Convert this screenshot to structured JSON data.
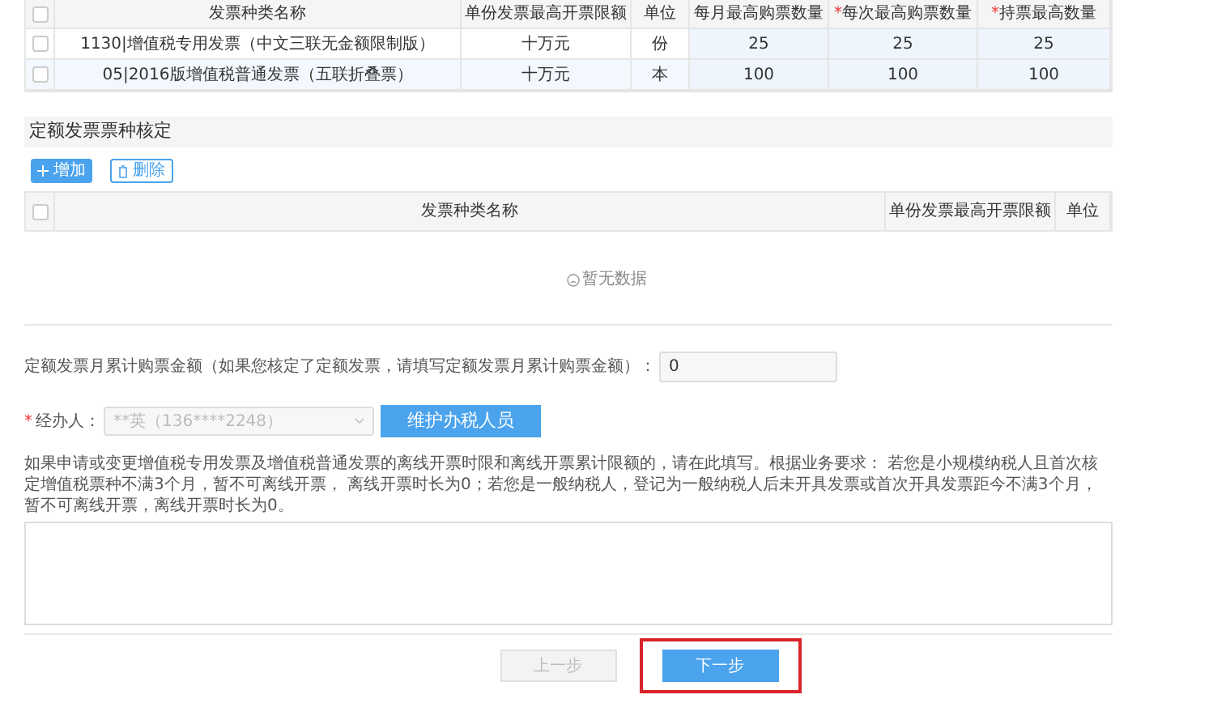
{
  "quota_table": {
    "all_checked": false,
    "columns": [
      {
        "label": "发票种类名称"
      },
      {
        "label": "单份发票最高开票限额"
      },
      {
        "label": "单位"
      },
      {
        "label": "每月最高购票数量"
      },
      {
        "label": "每次最高购票数量",
        "required_mark": "*"
      },
      {
        "label": "持票最高数量",
        "required_mark": "*"
      }
    ],
    "rows": [
      {
        "checked": false,
        "cells": [
          "1130|增值税专用发票（中文三联无金额限制版）",
          "十万元",
          "份",
          "25",
          "25",
          "25"
        ]
      },
      {
        "checked": false,
        "cells": [
          "05|2016版增值税普通发票（五联折叠票）",
          "十万元",
          "本",
          "100",
          "100",
          "100"
        ]
      }
    ]
  },
  "fixed_section": {
    "title": "定额发票票种核定",
    "buttons": [
      {
        "kind": "add",
        "label": "增加"
      },
      {
        "kind": "delete",
        "label": "删除"
      }
    ],
    "table": {
      "all_checked": false,
      "columns": [
        "发票种类名称",
        "单份发票最高开票限额",
        "单位"
      ]
    },
    "empty_text": "暂无数据"
  },
  "amount_field": {
    "label": "定额发票月累计购票金额（如果您核定了定额发票，请填写定额发票月累计购票金额）：",
    "value": "0"
  },
  "agent_field": {
    "label": "经办人：",
    "required_mark": "*",
    "placeholder": "**英（136****2248）",
    "button": "维护办税人员"
  },
  "offline_note": "如果申请或变更增值税专用发票及增值税普通发票的离线开票时限和离线开票累计限额的，请在此填写。根据业务要求： 若您是小规模纳税人且首次核定增值税票种不满3个月，暂不可离线开票， 离线开票时长为0；若您是一般纳税人，登记为一般纳税人后未开具发票或首次开具发票距今不满3个月，暂不可离线开票，离线开票时长为0。",
  "footer_buttons": [
    {
      "label": "上一步",
      "disabled": true,
      "highlighted": false
    },
    {
      "label": "下一步",
      "disabled": false,
      "highlighted": true
    }
  ]
}
